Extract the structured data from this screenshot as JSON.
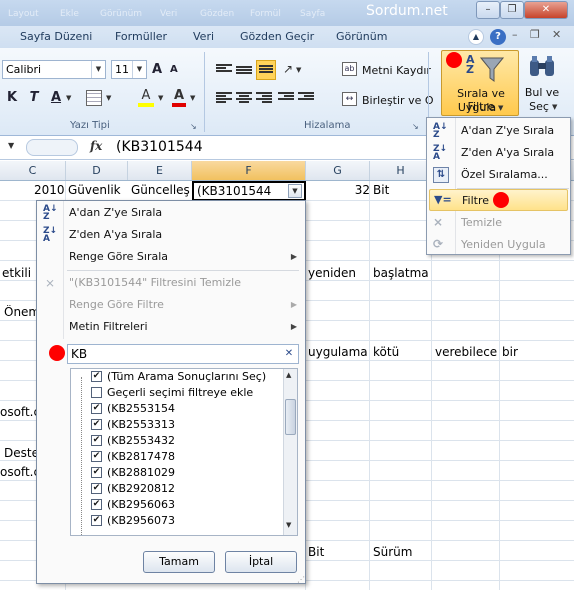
{
  "window": {
    "watermark": "Sordum.net",
    "ghost_tabs": [
      "Layout",
      "Ekle",
      "Görünüm",
      "Veri",
      "Gözden",
      "Formül",
      "Sayfa"
    ],
    "minimize": "–",
    "restore": "❐",
    "close": "✕",
    "help": "?"
  },
  "tabs": [
    "Sayfa Düzeni",
    "Formüller",
    "Veri",
    "Gözden Geçir",
    "Görünüm"
  ],
  "ribbon": {
    "font_name": "Calibri",
    "font_size": "11",
    "bold": "K",
    "italic": "T",
    "underline": "A",
    "fill_color_glyph": "A",
    "font_color_glyph": "A",
    "group_font_label": "Yazı Tipi",
    "group_align_label": "Hizalama",
    "wrap_text_label": "Metni Kaydır",
    "merge_label": "Birleştir ve O",
    "sort_filter_label_1": "Sırala ve Filtre",
    "sort_filter_label_2": "Uygula",
    "find_label_1": "Bul ve",
    "find_label_2": "Seç",
    "accent": "#ffd35a"
  },
  "formula_bar": {
    "fx": "fx",
    "value": "(KB3101544"
  },
  "columns": [
    "C",
    "D",
    "E",
    "F",
    "G",
    "H"
  ],
  "cells": {
    "r1": {
      "c": "2010",
      "d": "Güvenlik",
      "e": "Güncelleş",
      "f": "(KB3101544",
      "g": "32",
      "h": "Bit"
    },
    "etkili": "etkili",
    "yeniden": "yeniden",
    "baslatma": "başlatma",
    "onem": "Önem",
    "uygulama": "uygulama",
    "kotu": "kötü",
    "verebilecek": "verebilece",
    "bir": "bir",
    "microsoft1": "osoft.c",
    "deste": "Deste",
    "microsoft2": "osoft.c",
    "bit": "Bit",
    "surum": "Sürüm"
  },
  "sort_menu": {
    "items": [
      {
        "label": "A'dan Z'ye Sırala",
        "icon": "sort-az-icon",
        "enabled": true
      },
      {
        "label": "Z'den A'ya Sırala",
        "icon": "sort-za-icon",
        "enabled": true
      },
      {
        "label": "Özel Sıralama...",
        "icon": "custom-sort-icon",
        "enabled": true
      },
      {
        "label": "Filtre",
        "icon": "filter-icon",
        "enabled": true,
        "highlighted": true
      },
      {
        "label": "Temizle",
        "icon": "clear-filter-icon",
        "enabled": false
      },
      {
        "label": "Yeniden Uygula",
        "icon": "reapply-icon",
        "enabled": false
      }
    ]
  },
  "filter_panel": {
    "sort_az": "A'dan Z'ye Sırala",
    "sort_za": "Z'den A'ya Sırala",
    "sort_by_color": "Renge Göre Sırala",
    "clear_filter": "\"(KB3101544\" Filtresini Temizle",
    "filter_by_color": "Renge Göre Filtre",
    "text_filters": "Metin Filtreleri",
    "search_value": "KB",
    "search_clear": "✕",
    "list": [
      {
        "label": "(Tüm Arama Sonuçlarını Seç)",
        "checked": true
      },
      {
        "label": "Geçerli seçimi filtreye ekle",
        "checked": false
      },
      {
        "label": "(KB2553154",
        "checked": true
      },
      {
        "label": "(KB2553313",
        "checked": true
      },
      {
        "label": "(KB2553432",
        "checked": true
      },
      {
        "label": "(KB2817478",
        "checked": true
      },
      {
        "label": "(KB2881029",
        "checked": true
      },
      {
        "label": "(KB2920812",
        "checked": true
      },
      {
        "label": "(KB2956063",
        "checked": true
      },
      {
        "label": "(KB2956073",
        "checked": true
      }
    ],
    "ok": "Tamam",
    "cancel": "İptal"
  }
}
